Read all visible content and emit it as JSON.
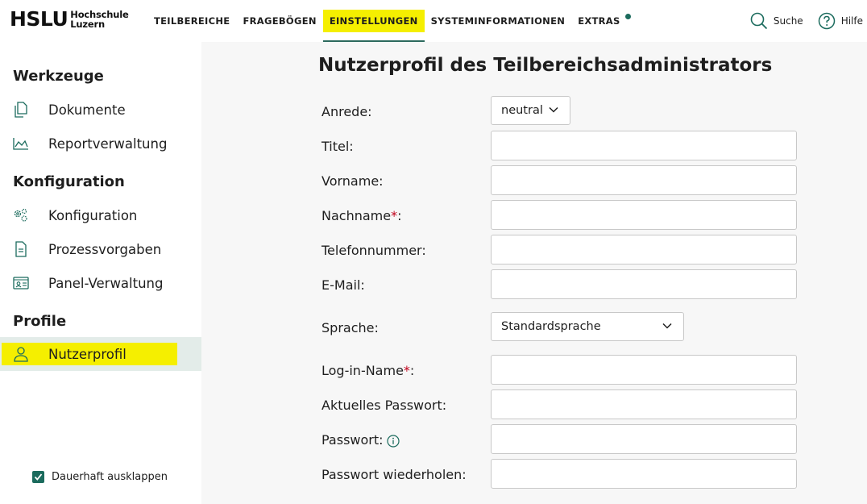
{
  "header": {
    "logo_main": "HSLU",
    "logo_sub_line1": "Hochschule",
    "logo_sub_line2": "Luzern",
    "nav": [
      "TEILBEREICHE",
      "FRAGEBÖGEN",
      "EINSTELLUNGEN",
      "SYSTEMINFORMATIONEN",
      "EXTRAS"
    ],
    "active_nav": "EINSTELLUNGEN",
    "search_label": "Suche",
    "help_label": "Hilfe"
  },
  "sidebar": {
    "sections": [
      {
        "heading": "Werkzeuge",
        "items": [
          {
            "label": "Dokumente",
            "icon": "documents-icon"
          },
          {
            "label": "Reportverwaltung",
            "icon": "chart-icon"
          }
        ]
      },
      {
        "heading": "Konfiguration",
        "items": [
          {
            "label": "Konfiguration",
            "icon": "gears-icon"
          },
          {
            "label": "Prozessvorgaben",
            "icon": "file-icon"
          },
          {
            "label": "Panel-Verwaltung",
            "icon": "id-card-icon"
          }
        ]
      },
      {
        "heading": "Profile",
        "items": [
          {
            "label": "Nutzerprofil",
            "icon": "user-icon",
            "active": true
          }
        ]
      }
    ],
    "keep_expanded_label": "Dauerhaft ausklappen",
    "keep_expanded_checked": true
  },
  "main": {
    "title": "Nutzerprofil des Teilbereichsadministrators",
    "fields": {
      "anrede": {
        "label": "Anrede:",
        "value": "neutral"
      },
      "titel": {
        "label": "Titel:",
        "value": ""
      },
      "vorname": {
        "label": "Vorname:",
        "value": ""
      },
      "nachname": {
        "label": "Nachname",
        "required_mark": "*",
        "suffix": ":",
        "value": ""
      },
      "telefon": {
        "label": "Telefonnummer:",
        "value": ""
      },
      "email": {
        "label": "E-Mail:",
        "value": ""
      },
      "sprache": {
        "label": "Sprache:",
        "value": "Standardsprache"
      },
      "login": {
        "label": "Log-in-Name",
        "required_mark": "*",
        "suffix": ":",
        "value": ""
      },
      "aktuelles_passwort": {
        "label": "Aktuelles Passwort:",
        "value": ""
      },
      "passwort": {
        "label": "Passwort:",
        "value": ""
      },
      "passwort_wdh": {
        "label": "Passwort wiederholen:",
        "value": ""
      }
    }
  },
  "colors": {
    "accent": "#1b6b5d",
    "highlight": "#f5ef00",
    "active_bg": "#e3ece9",
    "required": "#c0001a"
  }
}
